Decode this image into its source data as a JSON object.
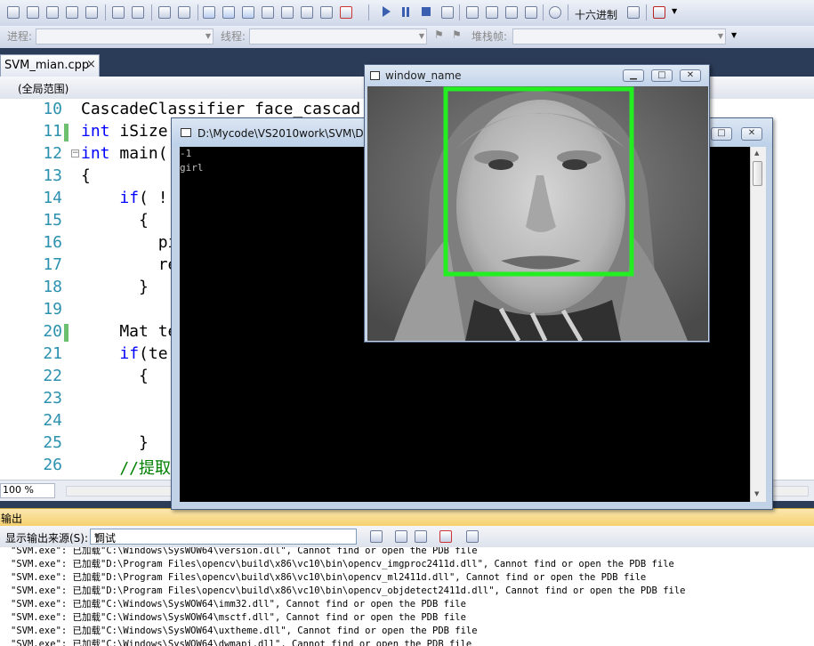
{
  "toolbar": {
    "hex_label": "十六进制"
  },
  "debug_location": {
    "process_label": "进程:",
    "thread_label": "线程:",
    "stack_label": "堆栈帧:"
  },
  "tabs": [
    {
      "label": "SVM_mian.cpp",
      "close": "×"
    }
  ],
  "scope": {
    "label": "(全局范围)"
  },
  "editor": {
    "line_numbers": [
      "10",
      "11",
      "12",
      "13",
      "14",
      "15",
      "16",
      "17",
      "18",
      "19",
      "20",
      "21",
      "22",
      "23",
      "24",
      "25",
      "26"
    ],
    "lines": [
      "CascadeClassifier face_cascad",
      "int iSize",
      "int main(",
      "{",
      "    if( !",
      "      {",
      "        pı",
      "        re",
      "      }",
      "",
      "    Mat te",
      "    if(te",
      "      {",
      "",
      "",
      "      }",
      "    //提取"
    ],
    "zoom": "100 %"
  },
  "console": {
    "title": "D:\\Mycode\\VS2010work\\SVM\\D",
    "lines": [
      "-1",
      "girl"
    ]
  },
  "image_window": {
    "title": "window_name",
    "detection_color": "#22ee22"
  },
  "output": {
    "header": "输出",
    "source_label": "显示输出来源(S):",
    "source_value": "调试",
    "lines": [
      "\"SVM.exe\": 已加载\"C:\\Windows\\SysWOW64\\version.dll\", Cannot find or open the PDB file",
      "\"SVM.exe\": 已加载\"D:\\Program Files\\opencv\\build\\x86\\vc10\\bin\\opencv_imgproc2411d.dll\", Cannot find or open the PDB file",
      "\"SVM.exe\": 已加载\"D:\\Program Files\\opencv\\build\\x86\\vc10\\bin\\opencv_ml2411d.dll\", Cannot find or open the PDB file",
      "\"SVM.exe\": 已加载\"D:\\Program Files\\opencv\\build\\x86\\vc10\\bin\\opencv_objdetect2411d.dll\", Cannot find or open the PDB file",
      "\"SVM.exe\": 已加载\"C:\\Windows\\SysWOW64\\imm32.dll\", Cannot find or open the PDB file",
      "\"SVM.exe\": 已加载\"C:\\Windows\\SysWOW64\\msctf.dll\", Cannot find or open the PDB file",
      "\"SVM.exe\": 已加载\"C:\\Windows\\SysWOW64\\uxtheme.dll\", Cannot find or open the PDB file",
      "\"SVM.exe\": 已加载\"C:\\Windows\\SysWOW64\\dwmapi.dll\", Cannot find or open the PDB file"
    ]
  }
}
